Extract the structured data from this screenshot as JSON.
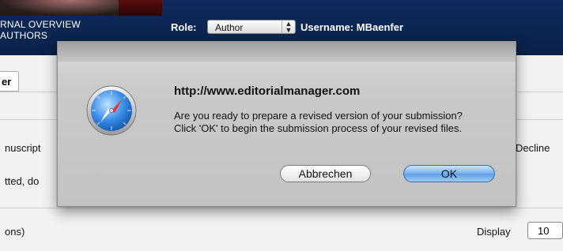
{
  "header": {
    "journal_nav": [
      "RNAL OVERVIEW",
      "AUTHORS"
    ],
    "role_label": "Role:",
    "role_value": "Author",
    "username_label": "Username: MBaenfer"
  },
  "page": {
    "tab_fragment": "er",
    "row1_left": "nuscript",
    "row1_right": "Decline",
    "row2_left": "tted, do",
    "row3_left": "ons)",
    "display_label": "Display",
    "display_value": "10"
  },
  "alert": {
    "title": "http://www.editorialmanager.com",
    "message": "Are you ready to prepare a revised version of your submission?  Click 'OK' to begin the submission process of your revised files.",
    "cancel_label": "Abbrechen",
    "ok_label": "OK",
    "icon": "safari-compass-icon",
    "ok_color": "#6aa8ef"
  }
}
